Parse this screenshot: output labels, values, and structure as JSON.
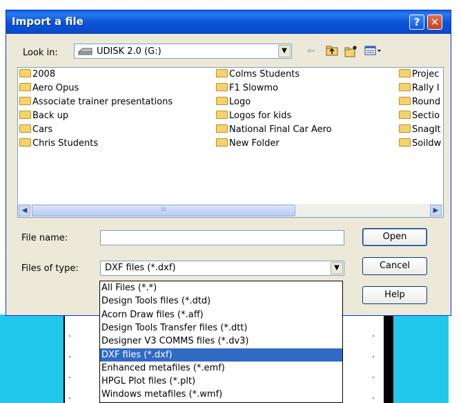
{
  "window": {
    "title": "Import a file",
    "help_label": "?",
    "close_label": "✕"
  },
  "look_in": {
    "label": "Look in:",
    "value": "UDISK 2.0 (G:)"
  },
  "toolbar": {
    "icons": [
      "back-arrow-icon",
      "up-folder-icon",
      "new-folder-icon",
      "view-menu-icon"
    ]
  },
  "files": {
    "column1": [
      "2008",
      "Aero Opus",
      "Associate trainer presentations",
      "Back up",
      "Cars",
      "Chris Students"
    ],
    "column2": [
      "Colms Students",
      "F1 Slowmo",
      "Logo",
      "Logos for kids",
      "National Final Car Aero",
      "New Folder"
    ],
    "column3": [
      "Projec",
      "Rally I",
      "Round",
      "Sectio",
      "SnagIt",
      "Soildw"
    ]
  },
  "scrollbar": {
    "thumb_label": "III"
  },
  "file_name": {
    "label": "File name:",
    "value": ""
  },
  "file_type": {
    "label": "Files of type:",
    "value": "DXF files (*.dxf)",
    "options": [
      "All Files (*.*)",
      "Design Tools files (*.dtd)",
      "Acorn Draw files (*.aff)",
      "Design Tools Transfer files (*.dtt)",
      "Designer V3 COMMS files (*.dv3)",
      "DXF files (*.dxf)",
      "Enhanced metafiles (*.emf)",
      "HPGL Plot files (*.plt)",
      "Windows metafiles (*.wmf)"
    ],
    "selected_index": 5
  },
  "buttons": {
    "open": "Open",
    "cancel": "Cancel",
    "help": "Help"
  },
  "colors": {
    "titlebar": "#0a55d8",
    "selection": "#316ac5",
    "dialog_bg": "#ece9d8"
  }
}
